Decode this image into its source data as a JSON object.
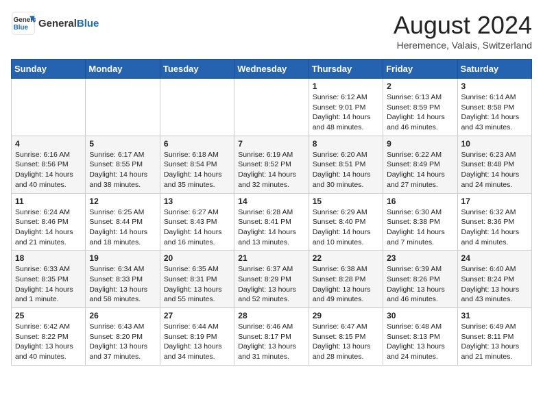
{
  "header": {
    "logo_general": "General",
    "logo_blue": "Blue",
    "month_year": "August 2024",
    "location": "Heremence, Valais, Switzerland"
  },
  "days_of_week": [
    "Sunday",
    "Monday",
    "Tuesday",
    "Wednesday",
    "Thursday",
    "Friday",
    "Saturday"
  ],
  "weeks": [
    [
      null,
      null,
      null,
      null,
      {
        "day": "1",
        "sunrise": "Sunrise: 6:12 AM",
        "sunset": "Sunset: 9:01 PM",
        "daylight": "Daylight: 14 hours and 48 minutes."
      },
      {
        "day": "2",
        "sunrise": "Sunrise: 6:13 AM",
        "sunset": "Sunset: 8:59 PM",
        "daylight": "Daylight: 14 hours and 46 minutes."
      },
      {
        "day": "3",
        "sunrise": "Sunrise: 6:14 AM",
        "sunset": "Sunset: 8:58 PM",
        "daylight": "Daylight: 14 hours and 43 minutes."
      }
    ],
    [
      {
        "day": "4",
        "sunrise": "Sunrise: 6:16 AM",
        "sunset": "Sunset: 8:56 PM",
        "daylight": "Daylight: 14 hours and 40 minutes."
      },
      {
        "day": "5",
        "sunrise": "Sunrise: 6:17 AM",
        "sunset": "Sunset: 8:55 PM",
        "daylight": "Daylight: 14 hours and 38 minutes."
      },
      {
        "day": "6",
        "sunrise": "Sunrise: 6:18 AM",
        "sunset": "Sunset: 8:54 PM",
        "daylight": "Daylight: 14 hours and 35 minutes."
      },
      {
        "day": "7",
        "sunrise": "Sunrise: 6:19 AM",
        "sunset": "Sunset: 8:52 PM",
        "daylight": "Daylight: 14 hours and 32 minutes."
      },
      {
        "day": "8",
        "sunrise": "Sunrise: 6:20 AM",
        "sunset": "Sunset: 8:51 PM",
        "daylight": "Daylight: 14 hours and 30 minutes."
      },
      {
        "day": "9",
        "sunrise": "Sunrise: 6:22 AM",
        "sunset": "Sunset: 8:49 PM",
        "daylight": "Daylight: 14 hours and 27 minutes."
      },
      {
        "day": "10",
        "sunrise": "Sunrise: 6:23 AM",
        "sunset": "Sunset: 8:48 PM",
        "daylight": "Daylight: 14 hours and 24 minutes."
      }
    ],
    [
      {
        "day": "11",
        "sunrise": "Sunrise: 6:24 AM",
        "sunset": "Sunset: 8:46 PM",
        "daylight": "Daylight: 14 hours and 21 minutes."
      },
      {
        "day": "12",
        "sunrise": "Sunrise: 6:25 AM",
        "sunset": "Sunset: 8:44 PM",
        "daylight": "Daylight: 14 hours and 18 minutes."
      },
      {
        "day": "13",
        "sunrise": "Sunrise: 6:27 AM",
        "sunset": "Sunset: 8:43 PM",
        "daylight": "Daylight: 14 hours and 16 minutes."
      },
      {
        "day": "14",
        "sunrise": "Sunrise: 6:28 AM",
        "sunset": "Sunset: 8:41 PM",
        "daylight": "Daylight: 14 hours and 13 minutes."
      },
      {
        "day": "15",
        "sunrise": "Sunrise: 6:29 AM",
        "sunset": "Sunset: 8:40 PM",
        "daylight": "Daylight: 14 hours and 10 minutes."
      },
      {
        "day": "16",
        "sunrise": "Sunrise: 6:30 AM",
        "sunset": "Sunset: 8:38 PM",
        "daylight": "Daylight: 14 hours and 7 minutes."
      },
      {
        "day": "17",
        "sunrise": "Sunrise: 6:32 AM",
        "sunset": "Sunset: 8:36 PM",
        "daylight": "Daylight: 14 hours and 4 minutes."
      }
    ],
    [
      {
        "day": "18",
        "sunrise": "Sunrise: 6:33 AM",
        "sunset": "Sunset: 8:35 PM",
        "daylight": "Daylight: 14 hours and 1 minute."
      },
      {
        "day": "19",
        "sunrise": "Sunrise: 6:34 AM",
        "sunset": "Sunset: 8:33 PM",
        "daylight": "Daylight: 13 hours and 58 minutes."
      },
      {
        "day": "20",
        "sunrise": "Sunrise: 6:35 AM",
        "sunset": "Sunset: 8:31 PM",
        "daylight": "Daylight: 13 hours and 55 minutes."
      },
      {
        "day": "21",
        "sunrise": "Sunrise: 6:37 AM",
        "sunset": "Sunset: 8:29 PM",
        "daylight": "Daylight: 13 hours and 52 minutes."
      },
      {
        "day": "22",
        "sunrise": "Sunrise: 6:38 AM",
        "sunset": "Sunset: 8:28 PM",
        "daylight": "Daylight: 13 hours and 49 minutes."
      },
      {
        "day": "23",
        "sunrise": "Sunrise: 6:39 AM",
        "sunset": "Sunset: 8:26 PM",
        "daylight": "Daylight: 13 hours and 46 minutes."
      },
      {
        "day": "24",
        "sunrise": "Sunrise: 6:40 AM",
        "sunset": "Sunset: 8:24 PM",
        "daylight": "Daylight: 13 hours and 43 minutes."
      }
    ],
    [
      {
        "day": "25",
        "sunrise": "Sunrise: 6:42 AM",
        "sunset": "Sunset: 8:22 PM",
        "daylight": "Daylight: 13 hours and 40 minutes."
      },
      {
        "day": "26",
        "sunrise": "Sunrise: 6:43 AM",
        "sunset": "Sunset: 8:20 PM",
        "daylight": "Daylight: 13 hours and 37 minutes."
      },
      {
        "day": "27",
        "sunrise": "Sunrise: 6:44 AM",
        "sunset": "Sunset: 8:19 PM",
        "daylight": "Daylight: 13 hours and 34 minutes."
      },
      {
        "day": "28",
        "sunrise": "Sunrise: 6:46 AM",
        "sunset": "Sunset: 8:17 PM",
        "daylight": "Daylight: 13 hours and 31 minutes."
      },
      {
        "day": "29",
        "sunrise": "Sunrise: 6:47 AM",
        "sunset": "Sunset: 8:15 PM",
        "daylight": "Daylight: 13 hours and 28 minutes."
      },
      {
        "day": "30",
        "sunrise": "Sunrise: 6:48 AM",
        "sunset": "Sunset: 8:13 PM",
        "daylight": "Daylight: 13 hours and 24 minutes."
      },
      {
        "day": "31",
        "sunrise": "Sunrise: 6:49 AM",
        "sunset": "Sunset: 8:11 PM",
        "daylight": "Daylight: 13 hours and 21 minutes."
      }
    ]
  ]
}
